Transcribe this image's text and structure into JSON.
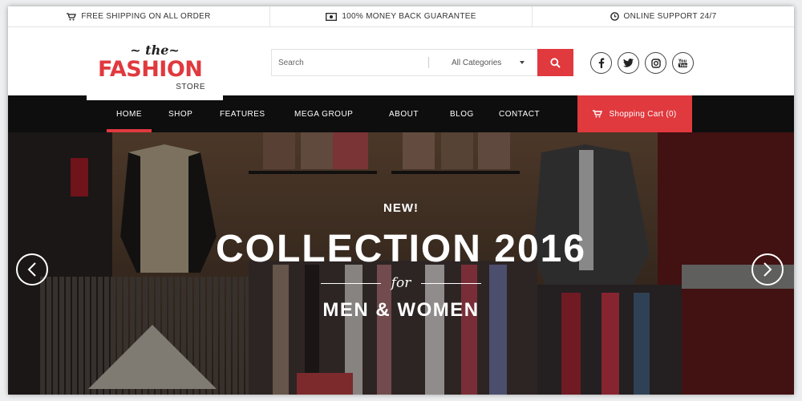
{
  "topbar": {
    "shipping": "FREE SHIPPING ON ALL ORDER",
    "guarantee": "100% MONEY BACK GUARANTEE",
    "support": "ONLINE SUPPORT 24/7"
  },
  "logo": {
    "the": "~ the~",
    "fashion": "FASHION",
    "store": "STORE"
  },
  "search": {
    "placeholder": "Search",
    "category": "All Categories"
  },
  "social": {
    "facebook": "f",
    "twitter": "t",
    "instagram": "ig",
    "youtube": "You"
  },
  "nav": {
    "items": [
      "HOME",
      "SHOP",
      "FEATURES",
      "MEGA GROUP",
      "ABOUT",
      "BLOG",
      "CONTACT"
    ],
    "active": "HOME",
    "cart": "Shopping Cart (0)"
  },
  "hero": {
    "kicker": "NEW!",
    "headline": "COLLECTION 2016",
    "for": "for",
    "sub": "MEN & WOMEN"
  },
  "colors": {
    "accent": "#e0393e",
    "nav_bg": "#0e0e0e"
  }
}
